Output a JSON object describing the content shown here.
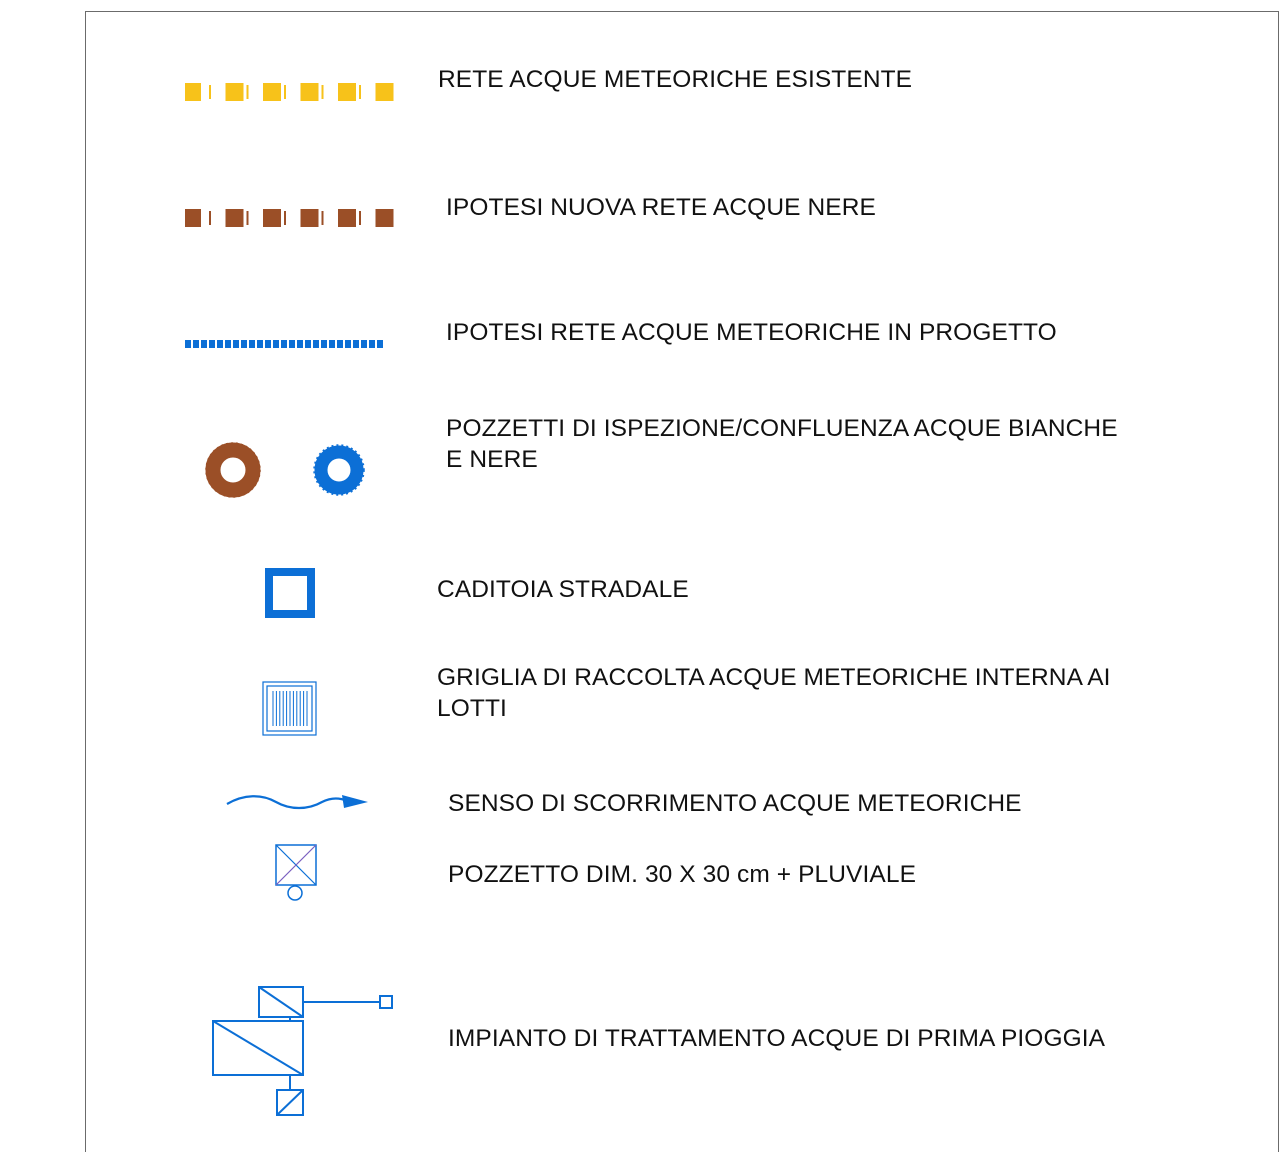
{
  "colors": {
    "existing_stormwater": "#F7C21A",
    "sewer": "#9B4F27",
    "project_blue": "#0C6FD6",
    "frame": "#6B6B6B"
  },
  "legend": {
    "items": [
      {
        "symbol": "yellow-dash-line-icon",
        "label": "RETE ACQUE METEORICHE ESISTENTE"
      },
      {
        "symbol": "brown-dash-line-icon",
        "label": "IPOTESI NUOVA RETE ACQUE NERE"
      },
      {
        "symbol": "blue-dotted-line-icon",
        "label": "IPOTESI RETE ACQUE METEORICHE IN PROGETTO"
      },
      {
        "symbol": "manhole-rings-icon",
        "label": "POZZETTI DI ISPEZIONE/CONFLUENZA ACQUE BIANCHE\nE NERE"
      },
      {
        "symbol": "street-drain-square-icon",
        "label": "CADITOIA STRADALE"
      },
      {
        "symbol": "grate-icon",
        "label": "GRIGLIA DI RACCOLTA ACQUE METEORICHE INTERNA AI\nLOTTI"
      },
      {
        "symbol": "wavy-arrow-icon",
        "label": "SENSO DI SCORRIMENTO ACQUE METEORICHE"
      },
      {
        "symbol": "small-pit-downpipe-icon",
        "label": "POZZETTO DIM. 30 X 30 cm + PLUVIALE"
      },
      {
        "symbol": "first-rain-plant-icon",
        "label": "IMPIANTO DI TRATTAMENTO ACQUE DI PRIMA PIOGGIA"
      }
    ]
  }
}
